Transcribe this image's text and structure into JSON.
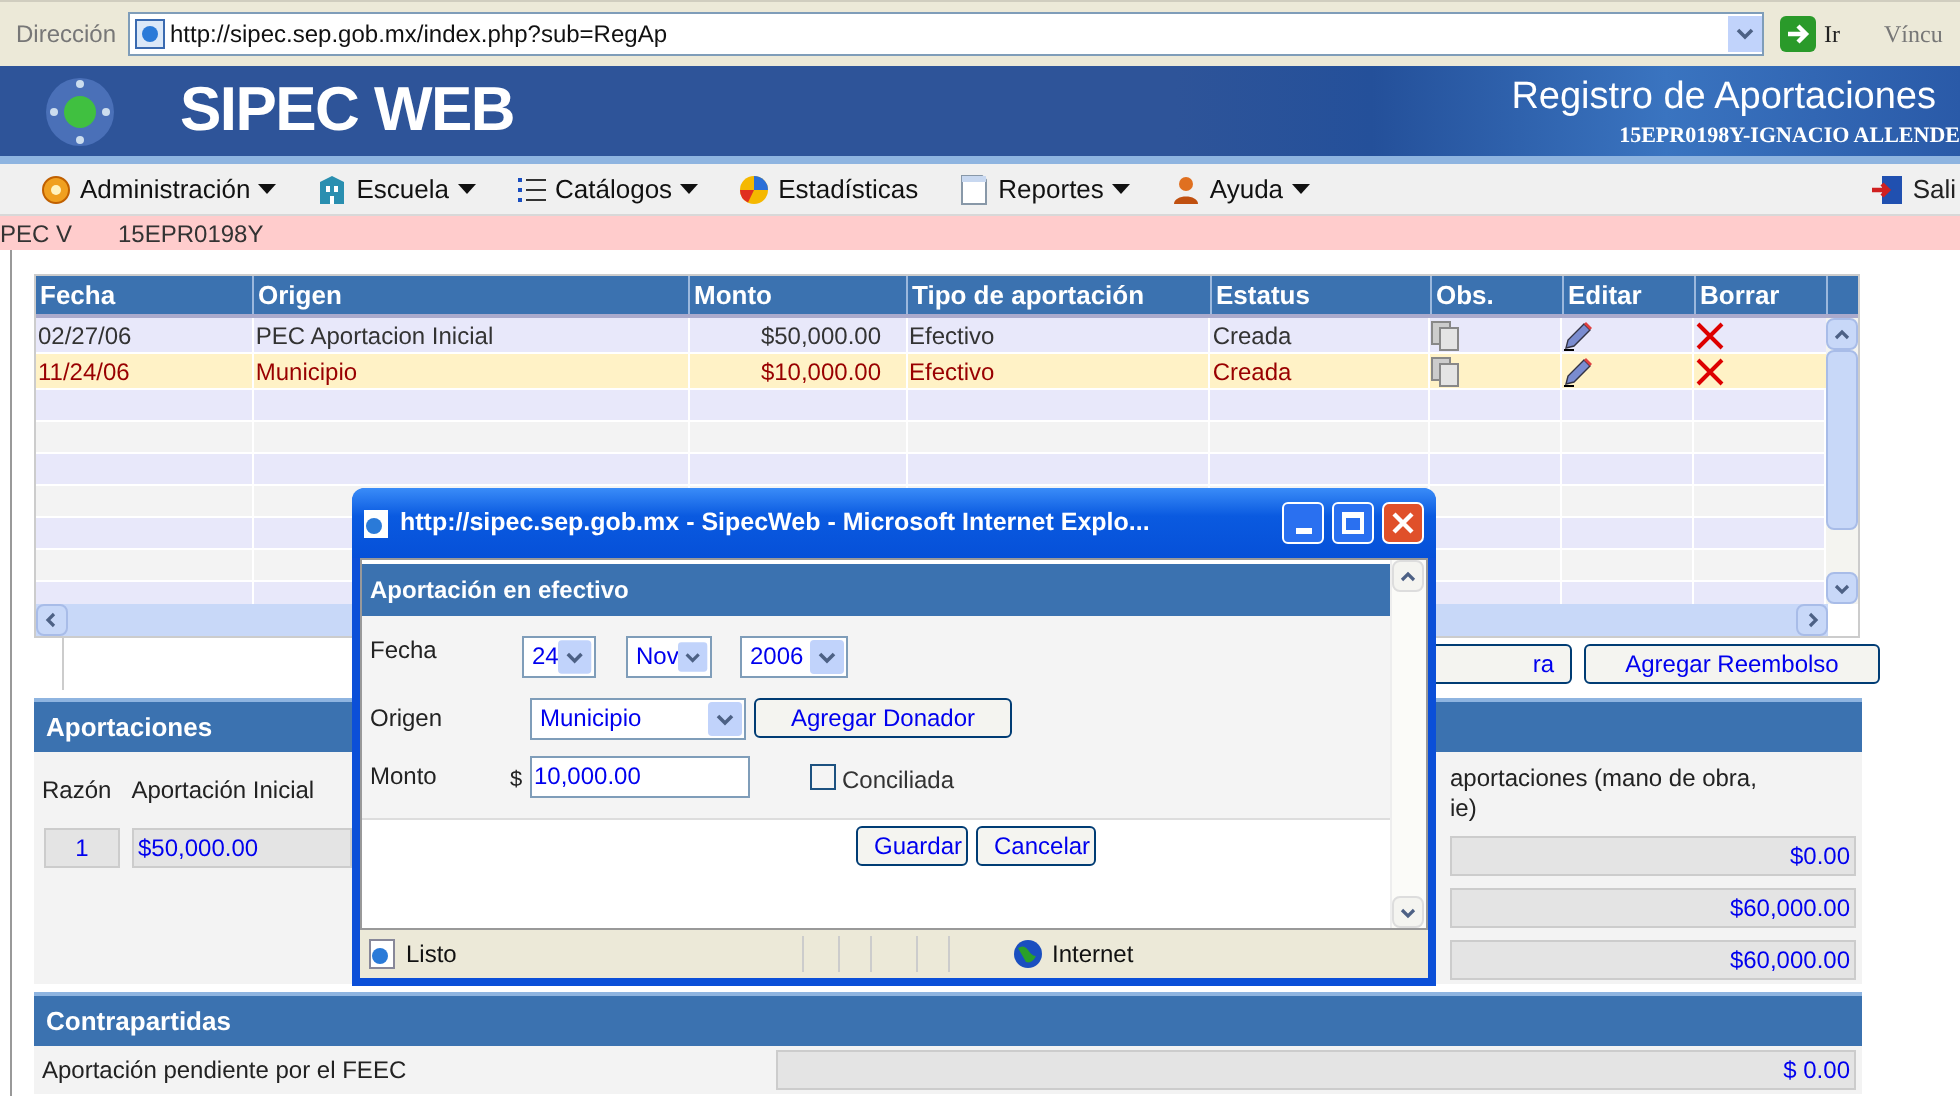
{
  "browser": {
    "address_label": "Dirección",
    "url": "http://sipec.sep.gob.mx/index.php?sub=RegAp",
    "go_label": "Ir",
    "links_label": "Víncu"
  },
  "header": {
    "title": "SIPEC WEB",
    "subtitle": "Registro de Aportaciones",
    "school": "15EPR0198Y-IGNACIO ALLENDE"
  },
  "menu": [
    {
      "label": "Administración",
      "kind": "gear",
      "dropdown": true
    },
    {
      "label": "Escuela",
      "kind": "building",
      "dropdown": true
    },
    {
      "label": "Catálogos",
      "kind": "list",
      "dropdown": true
    },
    {
      "label": "Estadísticas",
      "kind": "pie",
      "dropdown": false
    },
    {
      "label": "Reportes",
      "kind": "page",
      "dropdown": true
    },
    {
      "label": "Ayuda",
      "kind": "person",
      "dropdown": true
    }
  ],
  "exit": {
    "label": "Sali"
  },
  "context_bar": {
    "program": "PEC V",
    "cct": "15EPR0198Y"
  },
  "table": {
    "columns": [
      "Fecha",
      "Origen",
      "Monto",
      "Tipo de aportación",
      "Estatus",
      "Obs.",
      "Editar",
      "Borrar"
    ],
    "rows": [
      {
        "cells": [
          "02/27/06",
          "PEC Aportacion Inicial",
          "$50,000.00",
          "Efectivo",
          "Creada"
        ],
        "selected": false
      },
      {
        "cells": [
          "11/24/06",
          "Municipio",
          "$10,000.00",
          "Efectivo",
          "Creada"
        ],
        "selected": true
      }
    ]
  },
  "table_buttons": [
    "ra",
    "Agregar Reembolso"
  ],
  "aportaciones": {
    "title": "Aportaciones",
    "columns": [
      "Razón",
      "Aportación Inicial"
    ],
    "note_lines": [
      "aportaciones (mano de obra,",
      "ie)"
    ],
    "razon": "1",
    "inicial": "$50,000.00",
    "totals": [
      "$0.00",
      "$60,000.00",
      "$60,000.00"
    ]
  },
  "contrapartidas": {
    "title": "Contrapartidas",
    "rows": [
      {
        "label": "Aportación pendiente por el FEEC",
        "value": "$ 0.00"
      }
    ]
  },
  "dialog": {
    "title": "http://sipec.sep.gob.mx - SipecWeb - Microsoft Internet Explo...",
    "section": "Aportación en efectivo",
    "fecha_label": "Fecha",
    "day": "24",
    "month": "Nov",
    "year": "2006",
    "origen_label": "Origen",
    "origen": "Municipio",
    "add_donor": "Agregar Donador",
    "monto_label": "Monto",
    "currency": "$",
    "monto": "10,000.00",
    "conciliada": {
      "label": "Conciliada",
      "checked": false
    },
    "buttons": [
      "Guardar",
      "Cancelar"
    ],
    "status": "Listo",
    "zone": "Internet"
  }
}
